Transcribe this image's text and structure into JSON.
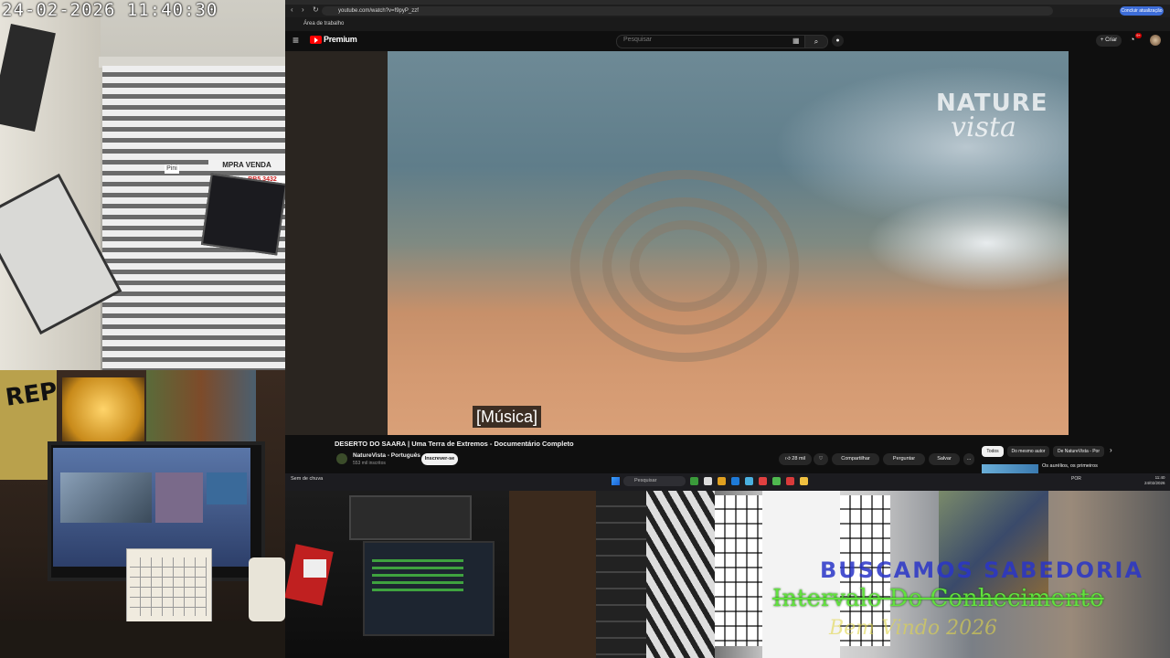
{
  "cams": {
    "timestamp": "24-02-2026  11:40:30",
    "street": {
      "sign_text": "MPRA  VENDA",
      "sign_phone": "BB5 3432",
      "pin_text": "Pini"
    },
    "desk": {
      "poster_text": "REP"
    },
    "room": {
      "overlay_line1": "BUSCAMOS SABEDORIA",
      "overlay_line2": "Intervalo Do Conhecimento",
      "overlay_line3": "Bem Vindo 2026"
    }
  },
  "browser": {
    "url": "youtube.com/watch?v=f9pyP_zzf",
    "bookmark": "Área de trabalho",
    "finish_update": "Concluir atualização",
    "youtube": {
      "brand": "Premium",
      "search_placeholder": "Pesquisar",
      "create_label": "+ Criar",
      "notification_count": "9+"
    },
    "player": {
      "watermark_line1": "NATURE",
      "watermark_line2": "vista",
      "caption": "[Música]"
    },
    "video": {
      "title": "DESERTO DO SAARA | Uma Terra de Extremos - Documentário Completo",
      "channel": "NatureVista - Português",
      "subscribers": "553 mil inscritos",
      "subscribe_label": "Inscrever-se",
      "likes": "28 mil",
      "share": "Compartilhar",
      "ask": "Perguntar",
      "save": "Salvar",
      "more": "..."
    },
    "chips": [
      "Todos",
      "Do mesmo autor",
      "De NatureVista - Por"
    ],
    "recommendation_title": "Os aurélios, os primeiros",
    "taskbar": {
      "weather": "Sem de chuva",
      "search_placeholder": "Pesquisar",
      "tray": "POR",
      "time": "11:40",
      "date": "24/02/2026"
    }
  }
}
